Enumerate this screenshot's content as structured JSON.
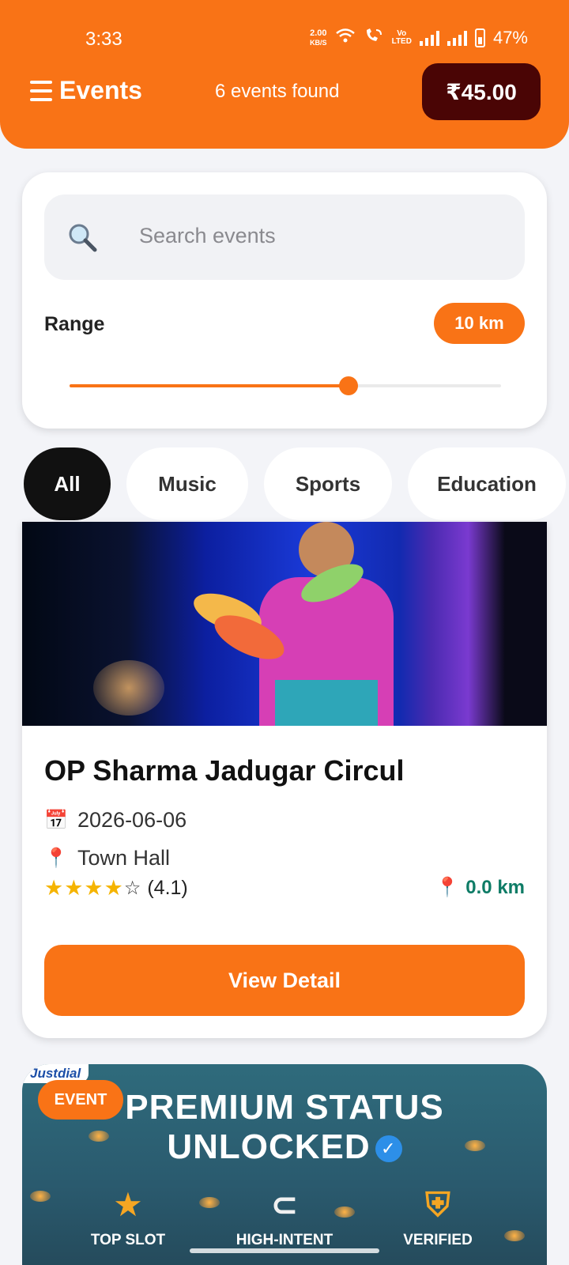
{
  "status_bar": {
    "time": "3:33",
    "net_speed_value": "2.00",
    "net_speed_unit": "KB/S",
    "volte_top": "Vo",
    "volte_bottom": "LTED",
    "battery": "47%"
  },
  "header": {
    "title": "Events",
    "events_count": "6 events found",
    "balance": "₹45.00"
  },
  "search": {
    "placeholder": "Search events",
    "value": ""
  },
  "range": {
    "label": "Range",
    "value_label": "10 km",
    "slider_fraction": 0.646
  },
  "categories": [
    {
      "label": "All",
      "active": true
    },
    {
      "label": "Music",
      "active": false
    },
    {
      "label": "Sports",
      "active": false
    },
    {
      "label": "Education",
      "active": false
    }
  ],
  "event": {
    "title": "OP Sharma Jadugar Circul",
    "date": "2026-06-06",
    "venue": "Town Hall",
    "stars_filled": "★★★★",
    "stars_empty": "☆",
    "rating_text": "(4.1)",
    "rating_value": 4.1,
    "distance": "0.0 km",
    "cta": "View Detail"
  },
  "ad": {
    "brand": "Justdial",
    "badge": "EVENT",
    "headline_line1": "PREMIUM STATUS",
    "headline_line2": "UNLOCKED",
    "features": [
      {
        "label": "TOP SLOT",
        "icon": "star-arrow-icon"
      },
      {
        "label": "HIGH-INTENT",
        "icon": "magnet-people-icon"
      },
      {
        "label": "VERIFIED",
        "icon": "shield-check-icon"
      }
    ]
  },
  "colors": {
    "accent": "#f97316",
    "balance_bg": "#4a0505",
    "distance": "#0e7c66",
    "star": "#f5b400"
  }
}
